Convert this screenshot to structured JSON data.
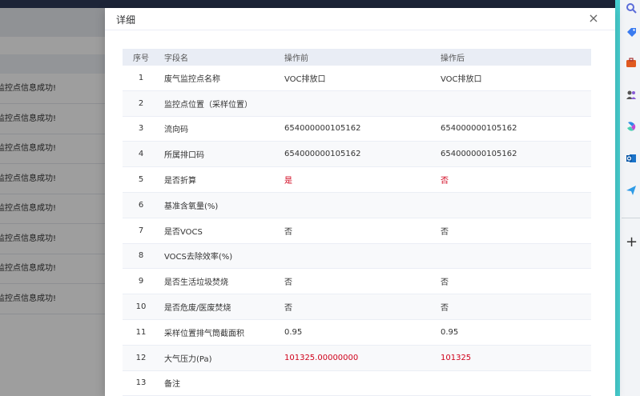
{
  "background": {
    "rows": [
      "监控点信息成功!",
      "监控点信息成功!",
      "监控点信息成功!",
      "监控点信息成功!",
      "监控点信息成功!",
      "监控点信息成功!",
      "监控点信息成功!",
      "监控点信息成功!"
    ]
  },
  "sidebar": {
    "icons": [
      "search-icon",
      "tag-icon",
      "briefcase-icon",
      "people-icon",
      "copilot-icon",
      "outlook-icon",
      "send-icon"
    ],
    "add_label": "+"
  },
  "dialog": {
    "title": "详细",
    "close_label": "×",
    "columns": {
      "index": "序号",
      "field": "字段名",
      "before": "操作前",
      "after": "操作后"
    },
    "rows": [
      {
        "index": "1",
        "field": "废气监控点名称",
        "before": "VOC排放口",
        "after": "VOC排放口",
        "highlight": false
      },
      {
        "index": "2",
        "field": "监控点位置（采样位置）",
        "before": "",
        "after": "",
        "highlight": false
      },
      {
        "index": "3",
        "field": "流向码",
        "before": "654000000105162",
        "after": "654000000105162",
        "highlight": false
      },
      {
        "index": "4",
        "field": "所属排口码",
        "before": "654000000105162",
        "after": "654000000105162",
        "highlight": false
      },
      {
        "index": "5",
        "field": "是否折算",
        "before": "是",
        "after": "否",
        "highlight": true
      },
      {
        "index": "6",
        "field": "基准含氧量(%)",
        "before": "",
        "after": "",
        "highlight": false
      },
      {
        "index": "7",
        "field": "是否VOCS",
        "before": "否",
        "after": "否",
        "highlight": false
      },
      {
        "index": "8",
        "field": "VOCS去除效率(%)",
        "before": "",
        "after": "",
        "highlight": false
      },
      {
        "index": "9",
        "field": "是否生活垃圾焚烧",
        "before": "否",
        "after": "否",
        "highlight": false
      },
      {
        "index": "10",
        "field": "是否危废/医废焚烧",
        "before": "否",
        "after": "否",
        "highlight": false
      },
      {
        "index": "11",
        "field": "采样位置排气筒截面积",
        "before": "0.95",
        "after": "0.95",
        "highlight": false
      },
      {
        "index": "12",
        "field": "大气压力(Pa)",
        "before": "101325.00000000",
        "after": "101325",
        "highlight": true
      },
      {
        "index": "13",
        "field": "备注",
        "before": "",
        "after": "",
        "highlight": false
      }
    ]
  }
}
